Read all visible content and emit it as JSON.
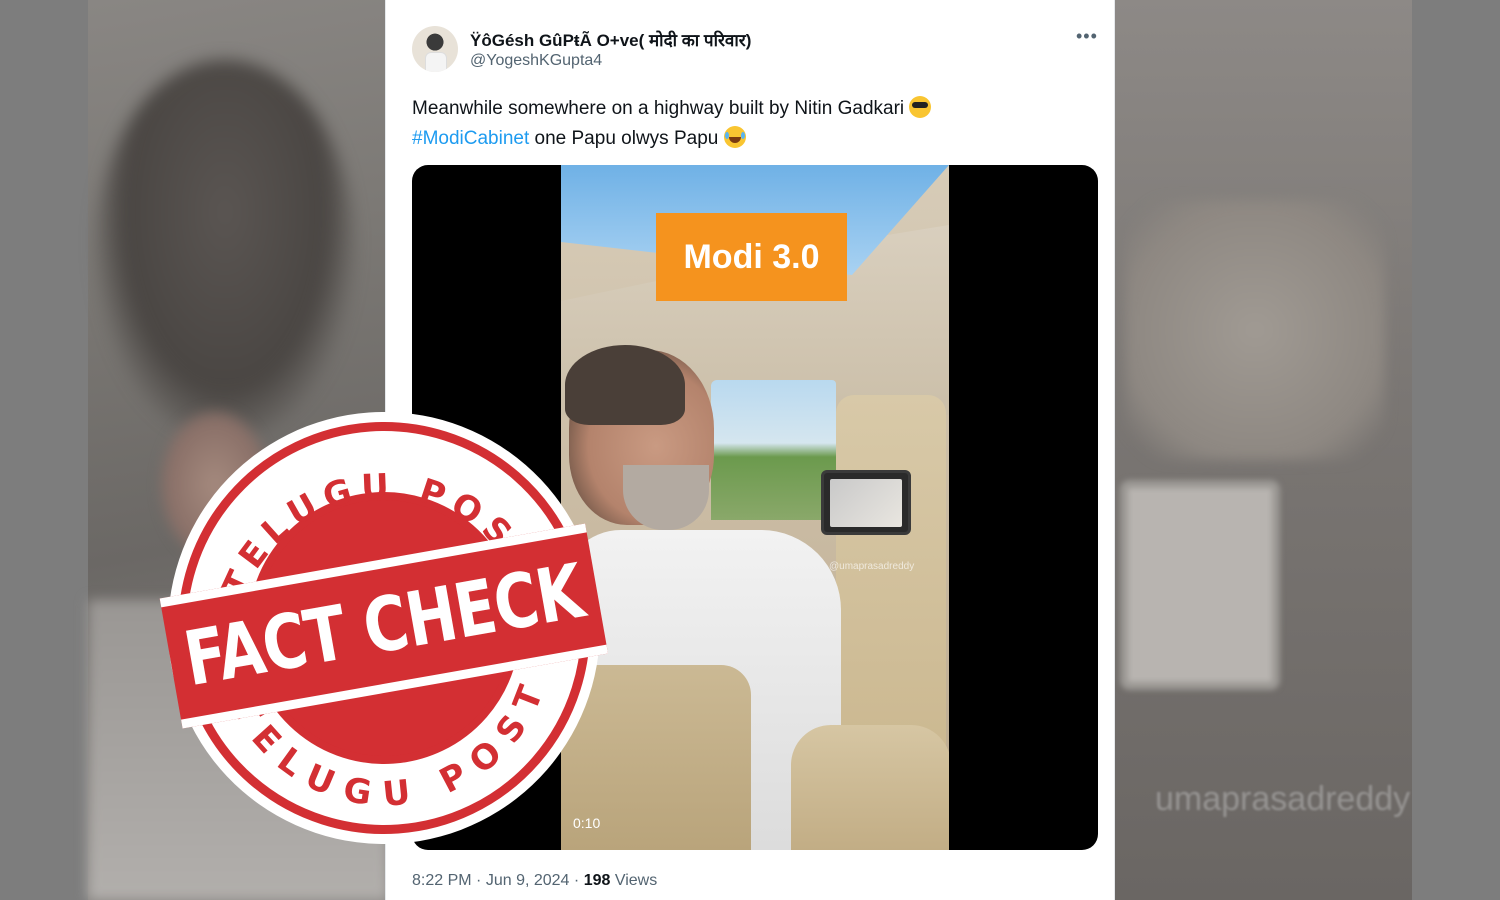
{
  "tweet": {
    "display_name": "ŸôGésh GûPŧÃ O+ve( मोदी का परिवार)",
    "handle": "@YogeshKGupta4",
    "more_label": "•••",
    "text_line1": "Meanwhile somewhere on a  highway built by Nitin Gadkari",
    "hashtag": "#ModiCabinet",
    "text_line2_rest": " one Papu olwys Papu",
    "emoji_1": "smiling-face-with-sunglasses",
    "emoji_2": "face-with-tears-of-joy",
    "time": "8:22 PM",
    "date": "Jun 9, 2024",
    "views_count": "198",
    "views_label": "Views",
    "separator": "·"
  },
  "video": {
    "overlay_label": "Modi 3.0",
    "watermark": "@umaprasadreddy",
    "timestamp": "0:10"
  },
  "stamp": {
    "top_text": "TELUGU POST",
    "center_text": "FACT CHECK",
    "bottom_text": "TELUGU POST",
    "color": "#d32f33"
  },
  "background": {
    "watermark": "umaprasadreddy"
  },
  "colors": {
    "accent": "#1d9bf0",
    "label_orange": "#f5931e"
  }
}
